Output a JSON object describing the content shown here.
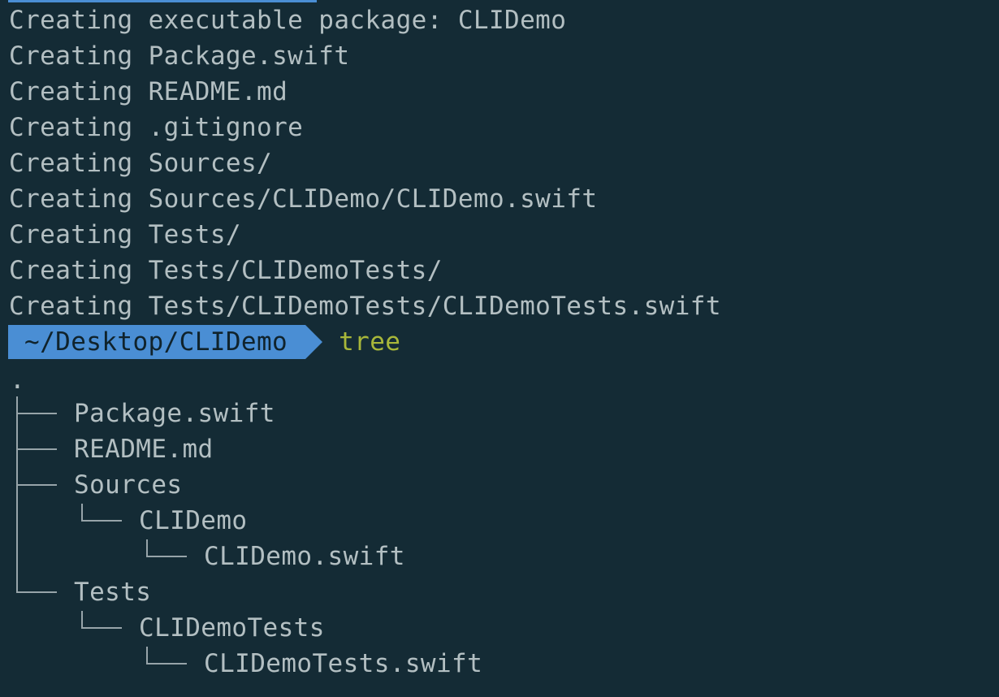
{
  "terminal": {
    "output_lines": [
      "Creating executable package: CLIDemo",
      "Creating Package.swift",
      "Creating README.md",
      "Creating .gitignore",
      "Creating Sources/",
      "Creating Sources/CLIDemo/CLIDemo.swift",
      "Creating Tests/",
      "Creating Tests/CLIDemoTests/",
      "Creating Tests/CLIDemoTests/CLIDemoTests.swift"
    ],
    "prompt": {
      "path": "~/Desktop/CLIDemo",
      "command": "tree"
    },
    "tree": {
      "root": ".",
      "entries": [
        "Package.swift",
        "README.md",
        "Sources",
        "CLIDemo",
        "CLIDemo.swift",
        "Tests",
        "CLIDemoTests",
        "CLIDemoTests.swift"
      ]
    }
  },
  "colors": {
    "background": "#142b35",
    "text": "#b3bfc2",
    "prompt_bg": "#4a8ed4",
    "command": "#a8b73a"
  }
}
